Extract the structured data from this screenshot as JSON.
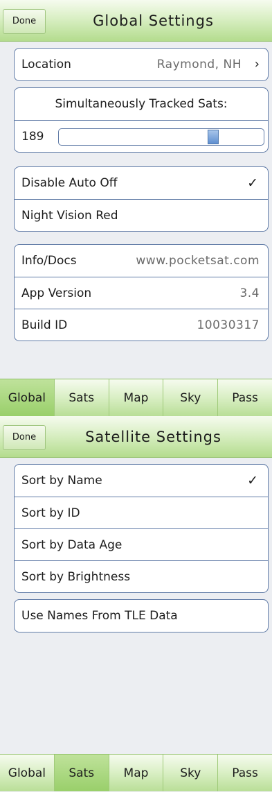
{
  "global_settings": {
    "done_label": "Done",
    "title": "Global Settings",
    "location_label": "Location",
    "location_value": "Raymond, NH",
    "tracked_label": "Simultaneously Tracked Sats:",
    "tracked_value": "189",
    "tracked_fraction": 0.77,
    "disable_auto_off_label": "Disable Auto Off",
    "disable_auto_off_checked": true,
    "night_vision_label": "Night Vision Red",
    "info_label": "Info/Docs",
    "info_value": "www.pocketsat.com",
    "version_label": "App Version",
    "version_value": "3.4",
    "build_label": "Build ID",
    "build_value": "10030317"
  },
  "satellite_settings": {
    "done_label": "Done",
    "title": "Satellite Settings",
    "sort_options": [
      "Sort by Name",
      "Sort by ID",
      "Sort by Data Age",
      "Sort by Brightness"
    ],
    "selected_sort": "Sort by Name",
    "use_tle_names_label": "Use Names From TLE Data"
  },
  "tabbar": {
    "tabs": [
      "Global",
      "Sats",
      "Map",
      "Sky",
      "Pass"
    ]
  },
  "glyphs": {
    "chevron": "›",
    "check": "✓"
  },
  "colors": {
    "accent_green": "#b4dc8e",
    "active_tab": "#99cf6a",
    "group_border": "#5f7aa6",
    "slider_thumb": "#5f8fd0"
  }
}
